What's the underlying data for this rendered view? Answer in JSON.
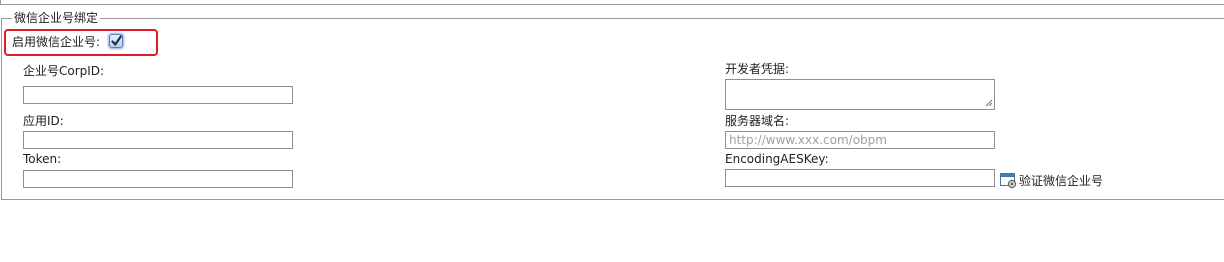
{
  "section": {
    "legend": "微信企业号绑定",
    "enable_label": "启用微信企业号:",
    "enable_checked": true
  },
  "left": {
    "corpid_label": "企业号CorpID:",
    "corpid_value": "",
    "appid_label": "应用ID:",
    "appid_value": "",
    "token_label": "Token:",
    "token_value": ""
  },
  "right": {
    "secret_label": "开发者凭据:",
    "secret_value": "",
    "domain_label": "服务器域名:",
    "domain_placeholder": "http://www.xxx.com/obpm",
    "aeskey_label": "EncodingAESKey:",
    "aeskey_value": "",
    "verify_button_label": "验证微信企业号"
  },
  "colors": {
    "highlight": "#e01b24",
    "border": "#9a9a9a"
  }
}
